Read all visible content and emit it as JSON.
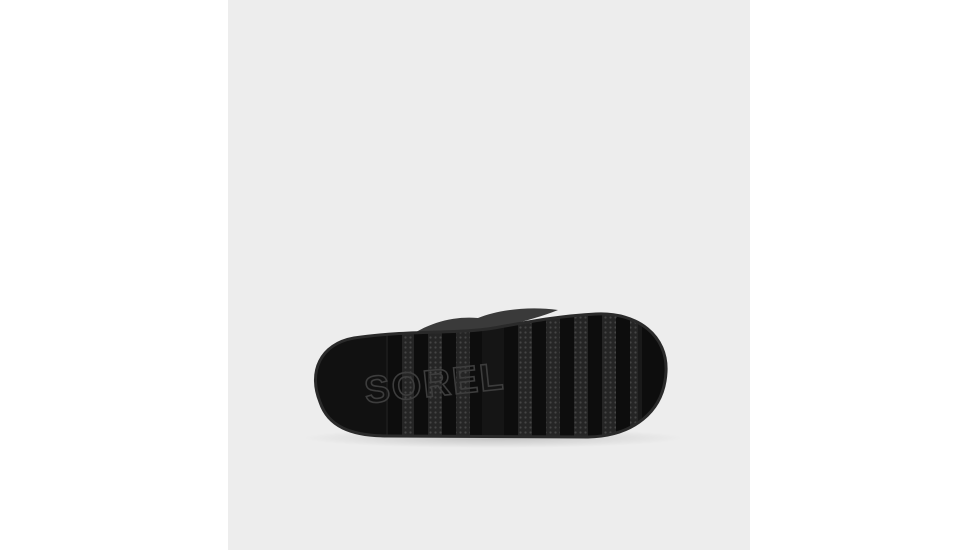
{
  "image": {
    "subject": "sole-of-black-boot",
    "brand_text": "SOREL",
    "colors": {
      "page_background": "#ffffff",
      "photo_background": "#ededed",
      "sole": "#1a1a1a",
      "lugs": "#0d0d0d",
      "grip_texture": "#2c2c2c",
      "upper": "#3a3a3a"
    }
  }
}
